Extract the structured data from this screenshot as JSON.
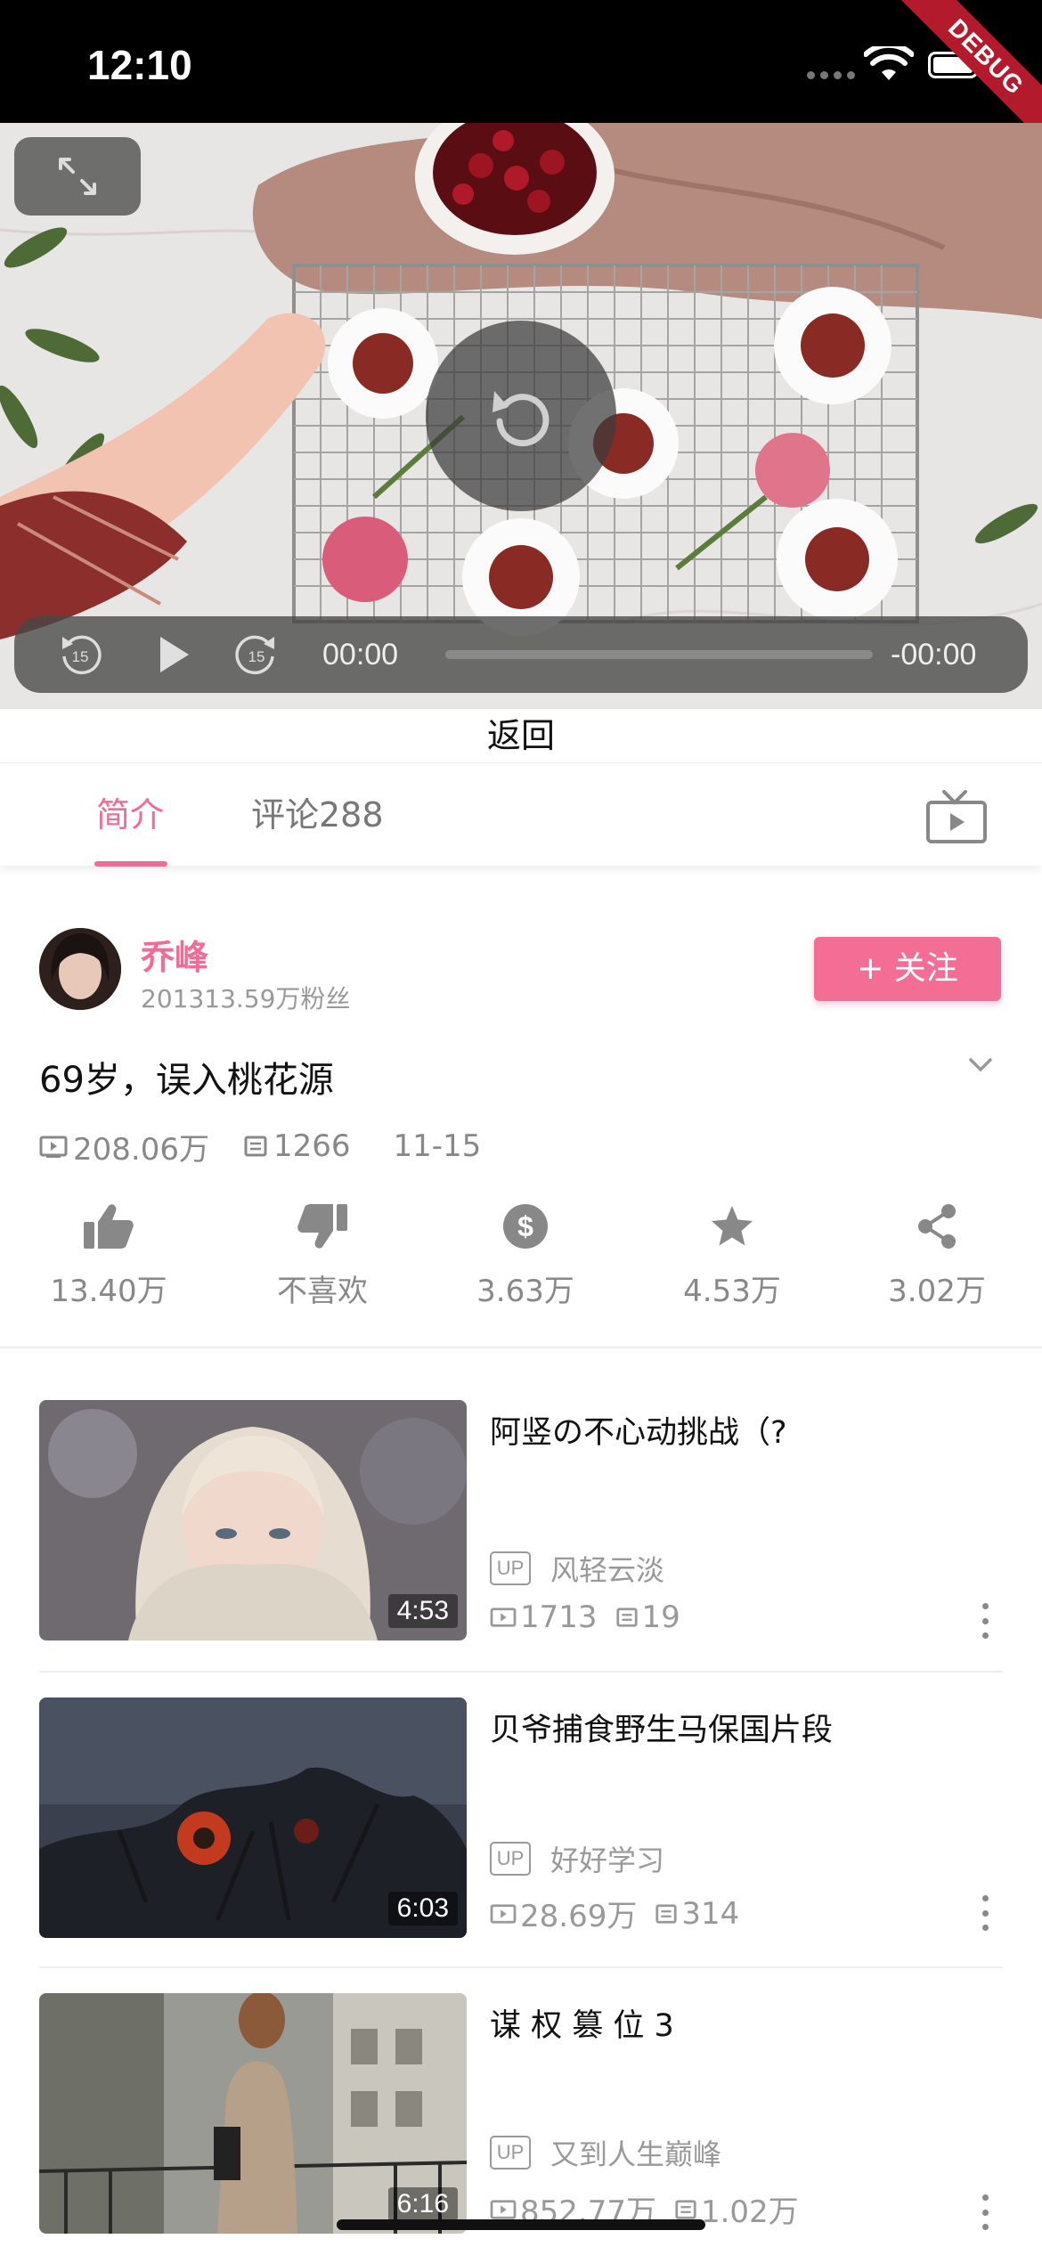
{
  "status_bar": {
    "time": "12:10",
    "debug_banner": "DEBUG"
  },
  "player": {
    "current_time": "00:00",
    "remaining_time": "-00:00",
    "skip_back_seconds": "15",
    "skip_forward_seconds": "15",
    "progress": 0,
    "back_label": "返回"
  },
  "tabs": [
    {
      "label": "简介",
      "active": true
    },
    {
      "label": "评论288",
      "active": false
    }
  ],
  "author": {
    "name": "乔峰",
    "fans": "201313.59万粉丝",
    "follow_label": "+ 关注"
  },
  "video": {
    "title": "69岁，误入桃花源",
    "views": "208.06万",
    "danmaku": "1266",
    "date": "11-15"
  },
  "actions": [
    {
      "icon": "thumb-up-icon",
      "label": "13.40万"
    },
    {
      "icon": "thumb-down-icon",
      "label": "不喜欢"
    },
    {
      "icon": "coin-icon",
      "label": "3.63万"
    },
    {
      "icon": "star-icon",
      "label": "4.53万"
    },
    {
      "icon": "share-icon",
      "label": "3.02万"
    }
  ],
  "related": [
    {
      "title": "阿竖の不心动挑战（?",
      "duration": "4:53",
      "up_tag": "UP",
      "uploader": "风轻云淡",
      "views": "1713",
      "danmaku": "19"
    },
    {
      "title": "贝爷捕食野生马保国片段",
      "duration": "6:03",
      "up_tag": "UP",
      "uploader": "好好学习",
      "views": "28.69万",
      "danmaku": "314"
    },
    {
      "title": "谋 权 篡 位 3",
      "duration": "6:16",
      "up_tag": "UP",
      "uploader": "又到人生巅峰",
      "views": "852.77万",
      "danmaku": "1.02万"
    }
  ],
  "colors": {
    "accent": "#f06b95",
    "follow_button": "#f46d94"
  }
}
